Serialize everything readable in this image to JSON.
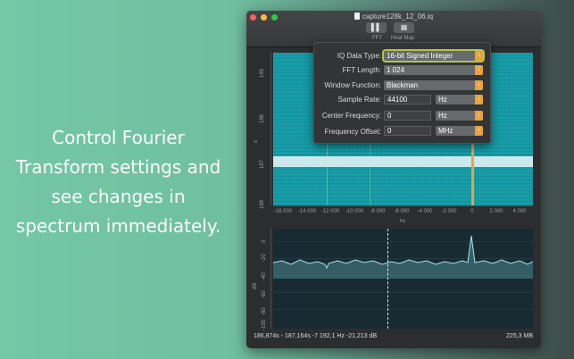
{
  "promo": {
    "lines": [
      "Control Fourier",
      "Transform settings and",
      "see changes in",
      "spectrum immediately."
    ]
  },
  "window": {
    "title": "capture128k_12_06.iq",
    "toolbar": {
      "fft_icon": "bar-chart-icon",
      "fft_label": "FFT",
      "heatmap_label": "Heat Map"
    }
  },
  "settings": {
    "iq_data_type": {
      "label": "IQ Data Type:",
      "value": "16-bit Signed Integer"
    },
    "fft_length": {
      "label": "FFT Length:",
      "value": "1 024"
    },
    "window_function": {
      "label": "Window Function:",
      "value": "Blackman"
    },
    "sample_rate": {
      "label": "Sample Rate:",
      "value": "44100",
      "unit": "Hz"
    },
    "center_frequency": {
      "label": "Center Frequency:",
      "value": "0",
      "unit": "Hz"
    },
    "frequency_offset": {
      "label": "Frequency Offset:",
      "value": "0",
      "unit": "MHz"
    }
  },
  "waterfall": {
    "y_axis_label": "s",
    "y_ticks": [
      "185",
      "186",
      "187",
      "188"
    ],
    "x_axis_label": "Hz",
    "x_ticks": [
      "-16 000",
      "-14 000",
      "-12 000",
      "-10 000",
      "-8 000",
      "-6 000",
      "-4 000",
      "-2 000",
      "0",
      "2 000",
      "4 000"
    ],
    "colors": {
      "background": "#139aa6",
      "band": "#cbe9ec",
      "marker": "#e8a33c"
    }
  },
  "spectrum": {
    "y_axis_label": "dB",
    "y_ticks": [
      "0",
      "-20",
      "-40",
      "-60",
      "-80",
      "-100"
    ],
    "colors": {
      "trace": "#8fd4dc",
      "background": "#182b33"
    }
  },
  "status": {
    "cursor": "186,874s - 187,164s  -7 192,1 Hz  -21,213 dB",
    "size": "225,3 MB"
  }
}
